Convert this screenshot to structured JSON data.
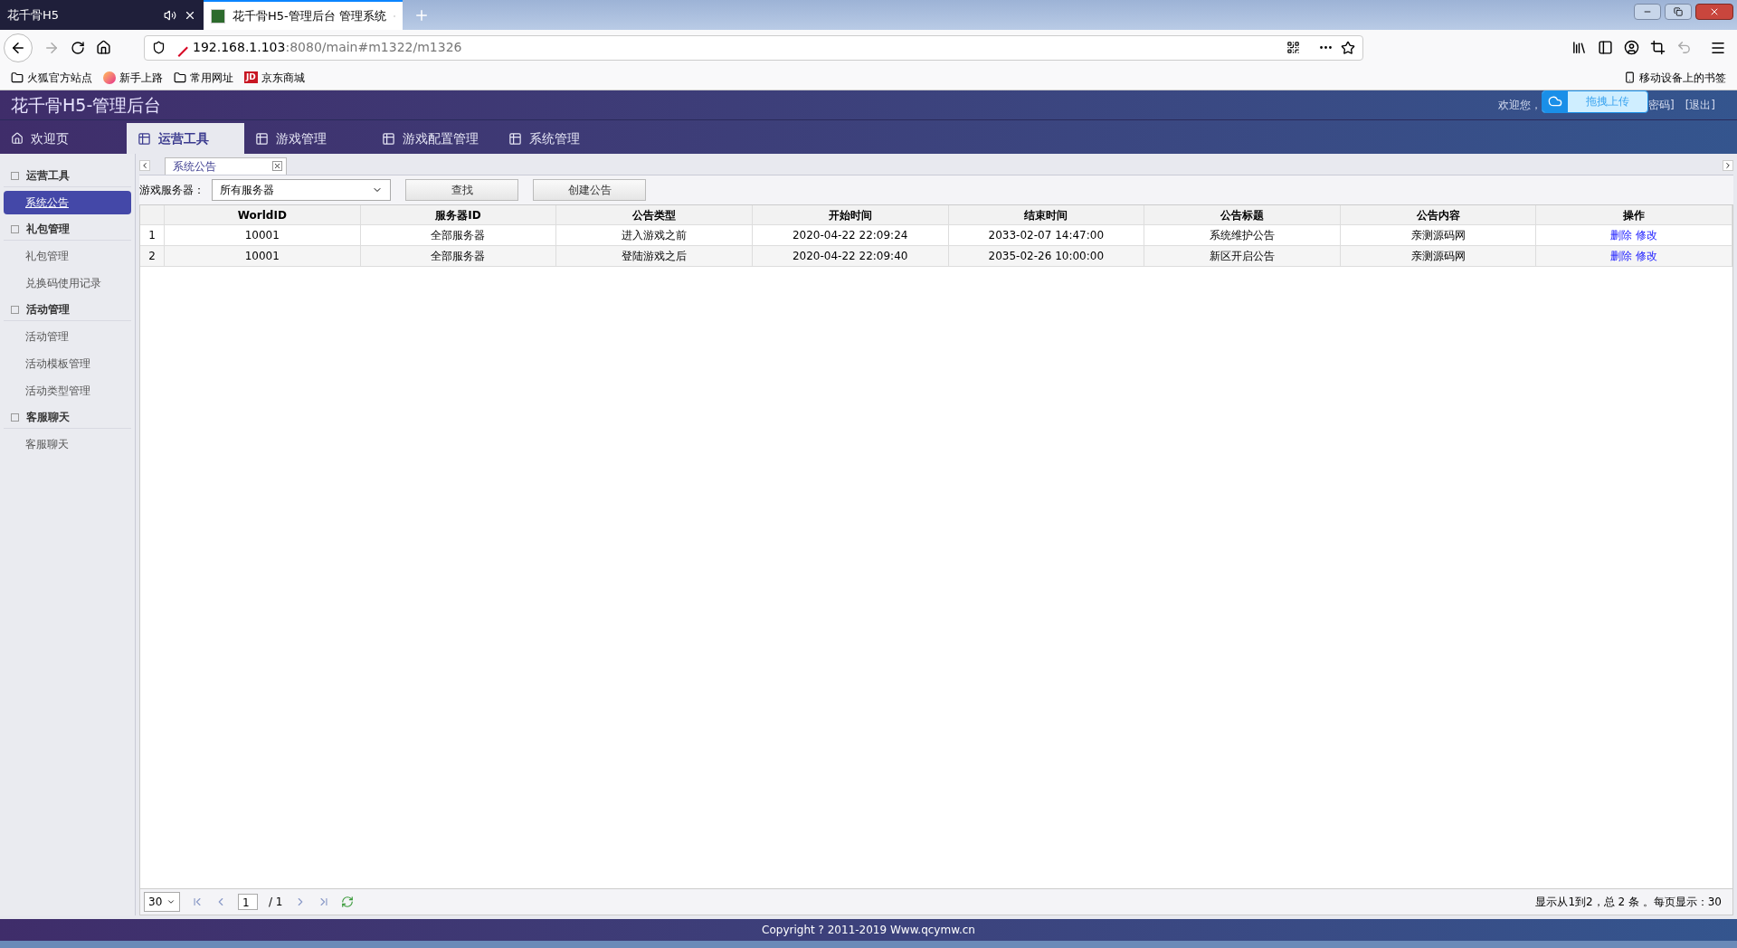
{
  "browser": {
    "tabs": [
      {
        "label": "花千骨H5",
        "selected": false,
        "audio": true
      },
      {
        "label": "花千骨H5-管理后台 管理系统",
        "selected": true,
        "audio": false
      }
    ],
    "url_host": "192.168.1.103",
    "url_rest": ":8080/main#m1322/m1326",
    "bookmarks": [
      {
        "kind": "folder",
        "label": "火狐官方站点"
      },
      {
        "kind": "firefox",
        "label": "新手上路"
      },
      {
        "kind": "folder",
        "label": "常用网址"
      },
      {
        "kind": "jd",
        "label": "京东商城",
        "badge": "JD"
      }
    ],
    "mobile_bookmarks": "移动设备上的书签"
  },
  "app": {
    "title": "花千骨H5-管理后台",
    "welcome": "欢迎您，",
    "change_password": "密码]",
    "logout": "[退出]",
    "upload_widget": "拖拽上传",
    "nav": [
      {
        "label": "欢迎页",
        "kind": "home",
        "selected": false
      },
      {
        "label": "运营工具",
        "kind": "grid",
        "selected": true
      },
      {
        "label": "游戏管理",
        "kind": "grid",
        "selected": false
      },
      {
        "label": "游戏配置管理",
        "kind": "grid",
        "selected": false
      },
      {
        "label": "系统管理",
        "kind": "grid",
        "selected": false
      }
    ]
  },
  "sidebar": [
    {
      "label": "运营工具",
      "expanded": true,
      "children": [
        {
          "label": "系统公告",
          "selected": true
        }
      ]
    },
    {
      "label": "礼包管理",
      "expanded": true,
      "children": [
        {
          "label": "礼包管理",
          "selected": false
        },
        {
          "label": "兑换码使用记录",
          "selected": false
        }
      ]
    },
    {
      "label": "活动管理",
      "expanded": true,
      "children": [
        {
          "label": "活动管理",
          "selected": false
        },
        {
          "label": "活动模板管理",
          "selected": false
        },
        {
          "label": "活动类型管理",
          "selected": false
        }
      ]
    },
    {
      "label": "客服聊天",
      "expanded": true,
      "children": [
        {
          "label": "客服聊天",
          "selected": false
        }
      ]
    }
  ],
  "content_tab": "系统公告",
  "filter": {
    "label": "游戏服务器：",
    "value": "所有服务器",
    "buttons": [
      "查找",
      "创建公告"
    ]
  },
  "table": {
    "columns": [
      "WorldID",
      "服务器ID",
      "公告类型",
      "开始时间",
      "结束时间",
      "公告标题",
      "公告内容",
      "操作"
    ],
    "rows": [
      {
        "index": "1",
        "cells": [
          "10001",
          "全部服务器",
          "进入游戏之前",
          "2020-04-22 22:09:24",
          "2033-02-07 14:47:00",
          "系统维护公告",
          "亲测源码网"
        ],
        "actions": [
          "删除",
          "修改"
        ]
      },
      {
        "index": "2",
        "cells": [
          "10001",
          "全部服务器",
          "登陆游戏之后",
          "2020-04-22 22:09:40",
          "2035-02-26 10:00:00",
          "新区开启公告",
          "亲测源码网"
        ],
        "actions": [
          "删除",
          "修改"
        ]
      }
    ]
  },
  "pager": {
    "page_size": "30",
    "page": "1",
    "total_pages": "/ 1",
    "summary": "显示从1到2，总 2 条 。每页显示：30"
  },
  "footer": "Copyright ? 2011-2019 Www.qcymw.cn"
}
